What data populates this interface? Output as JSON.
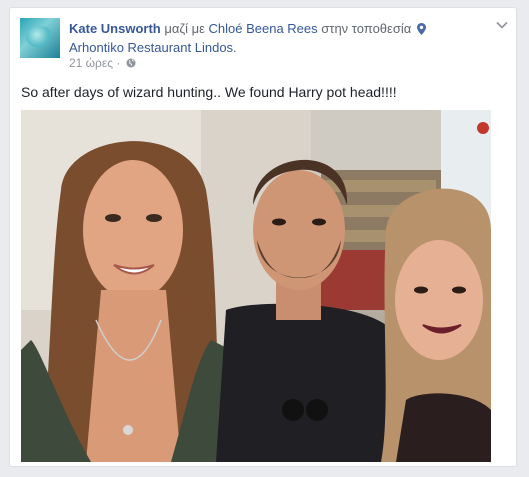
{
  "post": {
    "author": "Kate Unsworth",
    "with_text": "μαζί με",
    "tagged": "Chloé Beena Rees",
    "at_text": "στην τοποθεσία",
    "location": "Arhontiko Restaurant Lindos",
    "location_suffix": ".",
    "time": "21 ώρες",
    "separator": "·",
    "privacy_icon": "globe-icon",
    "message": "So after days of wizard hunting.. We found Harry pot head!!!!"
  },
  "colors": {
    "link": "#365899",
    "meta": "#90949c",
    "text": "#1d2129",
    "background": "#e9ebee"
  }
}
